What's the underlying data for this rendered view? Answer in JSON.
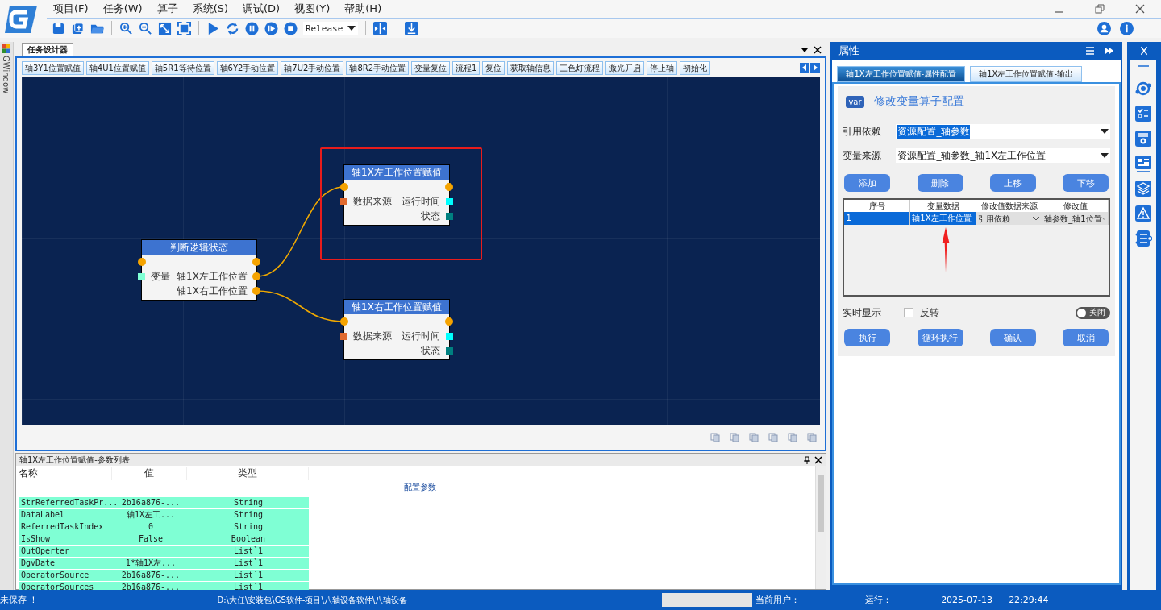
{
  "menu": [
    "项目(F)",
    "任务(W)",
    "算子",
    "系统(S)",
    "调试(D)",
    "视图(Y)",
    "帮助(H)"
  ],
  "toolbar": {
    "build_mode": "Release"
  },
  "side_tab": "GWindow",
  "designer": {
    "title": "任务设计器",
    "tabs": [
      "轴3Y1位置赋值",
      "轴4U1位置赋值",
      "轴5R1等待位置",
      "轴6Y2手动位置",
      "轴7U2手动位置",
      "轴8R2手动位置",
      "变量复位",
      "流程1",
      "复位",
      "获取轴信息",
      "三色灯流程",
      "激光开启",
      "停止轴",
      "初始化"
    ],
    "nodes": [
      {
        "title": "判断逻辑状态",
        "highlighted": false,
        "inputs": [
          {
            "label": "变量",
            "color": "#7fffd4"
          }
        ],
        "outputs": [
          {
            "label": "轴1X左工作位置",
            "kind": "circle",
            "color": "#f5a300"
          },
          {
            "label": "轴1X右工作位置",
            "kind": "circle",
            "color": "#f5a300"
          }
        ]
      },
      {
        "title": "轴1X左工作位置赋值",
        "highlighted": true,
        "inputs": [
          {
            "label": "数据来源",
            "color": "#e06a30"
          }
        ],
        "outputs": [
          {
            "label": "运行时间",
            "kind": "square",
            "color": "#00ffff"
          },
          {
            "label": "状态",
            "kind": "square",
            "color": "#008080"
          }
        ]
      },
      {
        "title": "轴1X右工作位置赋值",
        "highlighted": false,
        "inputs": [
          {
            "label": "数据来源",
            "color": "#e06a30"
          }
        ],
        "outputs": [
          {
            "label": "运行时间",
            "kind": "square",
            "color": "#00ffff"
          },
          {
            "label": "状态",
            "kind": "square",
            "color": "#008080"
          }
        ]
      }
    ]
  },
  "param_list": {
    "title": "轴1X左工作位置赋值-参数列表",
    "columns": [
      "名称",
      "值",
      "类型"
    ],
    "group": "配置参数",
    "rows": [
      {
        "name": "StrReferredTaskPr...",
        "value": "2b16a876-...",
        "type": "String"
      },
      {
        "name": "DataLabel",
        "value": "轴1X左工...",
        "type": "String"
      },
      {
        "name": "ReferredTaskIndex",
        "value": "0",
        "type": "String"
      },
      {
        "name": "IsShow",
        "value": "False",
        "type": "Boolean"
      },
      {
        "name": "OutOperter",
        "value": "",
        "type": "List`1"
      },
      {
        "name": "DgvDate",
        "value": "1*轴1X左...",
        "type": "List`1"
      },
      {
        "name": "OperatorSource",
        "value": "2b16a876-...",
        "type": "List`1"
      },
      {
        "name": "OperatorSources",
        "value": "2b16a876-...",
        "type": "List`1"
      }
    ]
  },
  "properties": {
    "title": "属性",
    "tabs": [
      {
        "label": "轴1X左工作位置赋值-属性配置",
        "selected": true
      },
      {
        "label": "轴1X左工作位置赋值-输出",
        "selected": false
      }
    ],
    "heading_icon_text": "var",
    "heading": "修改变量算子配置",
    "fields": [
      {
        "label": "引用依赖",
        "value": "资源配置_轴参数",
        "selected": true
      },
      {
        "label": "变量来源",
        "value": "资源配置_轴参数_轴1X左工作位置",
        "selected": false
      }
    ],
    "actions": [
      "添加",
      "删除",
      "上移",
      "下移"
    ],
    "table": {
      "columns": [
        "序号",
        "变量数据",
        "修改值数据来源",
        "修改值"
      ],
      "rows": [
        {
          "index": "1",
          "variable": "轴1X左工作位置",
          "source": "引用依赖",
          "new_value": "轴参数_轴1位置",
          "selected": true
        }
      ]
    },
    "realtime_label": "实时显示",
    "invert": {
      "label": "反转",
      "checked": false
    },
    "toggle": {
      "label": "关闭",
      "on": false
    },
    "buttons": [
      "执行",
      "循环执行",
      "确认",
      "取消"
    ]
  },
  "status_bar": {
    "save_state": "未保存 ！",
    "path": "D:\\大任\\安装包\\GS软件-项目\\八轴设备软件\\八轴设备",
    "user_label": "当前用户：",
    "run_label": "运行：",
    "date": "2025-07-13",
    "time": "22:29:44"
  }
}
